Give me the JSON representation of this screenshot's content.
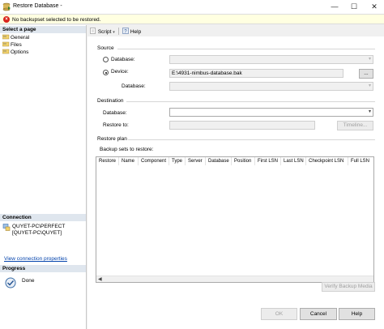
{
  "window": {
    "title": "Restore Database -"
  },
  "error": {
    "message": "No backupset selected to be restored."
  },
  "left": {
    "select_page_header": "Select a page",
    "pages": [
      {
        "label": "General"
      },
      {
        "label": "Files"
      },
      {
        "label": "Options"
      }
    ],
    "connection_header": "Connection",
    "connection_line1": "QUYET-PC\\PERFECT",
    "connection_line2": "[QUYET-PC\\QUYET]",
    "view_connection": "View connection properties",
    "progress_header": "Progress",
    "progress_status": "Done"
  },
  "toolbar": {
    "script_label": "Script",
    "help_label": "Help"
  },
  "source": {
    "section": "Source",
    "database_label": "Database:",
    "device_label": "Device:",
    "device_value": "E:\\4931-nimbus-database.bak",
    "browse_label": "...",
    "database2_label": "Database:",
    "selected": "device"
  },
  "destination": {
    "section": "Destination",
    "database_label": "Database:",
    "database_value": "",
    "restore_to_label": "Restore to:",
    "restore_to_value": "",
    "timeline_label": "Timeline..."
  },
  "restore_plan": {
    "section": "Restore plan",
    "backup_sets_label": "Backup sets to restore:",
    "columns": [
      "Restore",
      "Name",
      "Component",
      "Type",
      "Server",
      "Database",
      "Position",
      "First LSN",
      "Last LSN",
      "Checkpoint LSN",
      "Full LSN"
    ],
    "verify_label": "Verify Backup Media"
  },
  "footer": {
    "ok_label": "OK",
    "cancel_label": "Cancel",
    "help_label": "Help"
  },
  "colors": {
    "error_bg": "#ffffe1",
    "error_icon": "#d9231c",
    "link": "#0645ad",
    "header_bg": "#dfe6ee"
  }
}
